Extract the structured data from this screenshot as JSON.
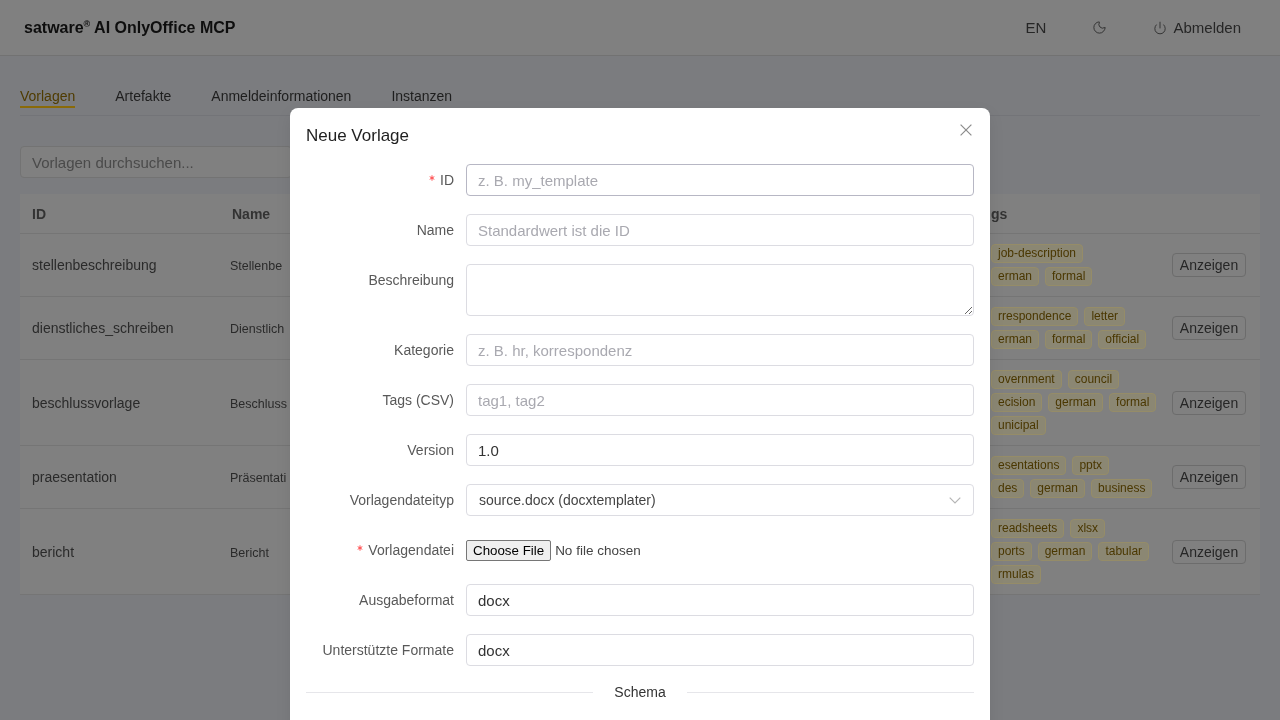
{
  "header": {
    "title": "satware$^{®}$ AI OnlyOffice MCP",
    "language": "EN",
    "logout": "Abmelden"
  },
  "tabs": [
    {
      "label": "Vorlagen",
      "selected": true
    },
    {
      "label": "Artefakte",
      "selected": false
    },
    {
      "label": "Anmeldeinformationen",
      "selected": false
    },
    {
      "label": "Instanzen",
      "selected": false
    }
  ],
  "search": {
    "placeholder": "Vorlagen durchsuchen..."
  },
  "table": {
    "columns": [
      "ID",
      "Name",
      "gs"
    ],
    "rows": [
      {
        "id": "stellenbeschreibung",
        "name": "Stellenbe",
        "tag_lines": [
          [
            "job-description"
          ],
          [
            "erman",
            "formal"
          ]
        ],
        "action": "Anzeigen"
      },
      {
        "id": "dienstliches_schreiben",
        "name": "Dienstlich",
        "tag_lines": [
          [
            "rrespondence",
            "letter"
          ],
          [
            "erman",
            "formal",
            "official"
          ]
        ],
        "action": "Anzeigen"
      },
      {
        "id": "beschlussvorlage",
        "name": "Beschluss",
        "tag_lines": [
          [
            "overnment",
            "council"
          ],
          [
            "ecision",
            "german",
            "formal"
          ],
          [
            "unicipal"
          ]
        ],
        "action": "Anzeigen"
      },
      {
        "id": "praesentation",
        "name": "Präsentati",
        "tag_lines": [
          [
            "esentations",
            "pptx"
          ],
          [
            "des",
            "german",
            "business"
          ]
        ],
        "action": "Anzeigen"
      },
      {
        "id": "bericht",
        "name": "Bericht",
        "tag_lines": [
          [
            "readsheets",
            "xlsx"
          ],
          [
            "ports",
            "german",
            "tabular"
          ],
          [
            "rmulas"
          ]
        ],
        "action": "Anzeigen"
      }
    ]
  },
  "dialog": {
    "title": "Neue Vorlage",
    "fields": [
      {
        "kind": "text",
        "label": "ID",
        "required": true,
        "placeholder": "z. B. my_template",
        "focused": true
      },
      {
        "kind": "text",
        "label": "Name",
        "required": false,
        "placeholder": "Standardwert ist die ID",
        "focused": false
      },
      {
        "kind": "textarea",
        "label": "Beschreibung",
        "required": false,
        "focused": false
      },
      {
        "kind": "text",
        "label": "Kategorie",
        "required": false,
        "placeholder": "z. B. hr, korrespondenz",
        "focused": false
      },
      {
        "kind": "text",
        "label": "Tags (CSV)",
        "required": false,
        "placeholder": "tag1, tag2",
        "focused": false
      },
      {
        "kind": "text",
        "label": "Version",
        "required": false,
        "value": "1.0",
        "focused": false
      },
      {
        "kind": "select",
        "label": "Vorlagendateityp",
        "required": false,
        "value": "source.docx (docxtemplater)",
        "focused": false
      },
      {
        "kind": "file",
        "label": "Vorlagendatei",
        "required": true,
        "button": "Choose File",
        "status": "No file chosen"
      },
      {
        "kind": "text",
        "label": "Ausgabeformat",
        "required": false,
        "value": "docx",
        "focused": false
      },
      {
        "kind": "text",
        "label": "Unterstützte Formate",
        "required": false,
        "value": "docx",
        "focused": false
      }
    ],
    "divider": "Schema"
  }
}
